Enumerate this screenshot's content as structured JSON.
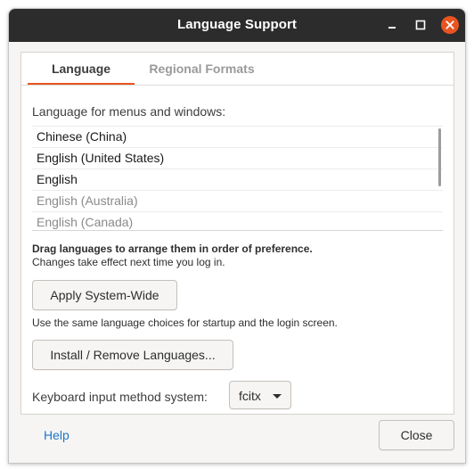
{
  "window": {
    "title": "Language Support"
  },
  "tabs": [
    {
      "label": "Language"
    },
    {
      "label": "Regional Formats"
    }
  ],
  "language": {
    "list_label": "Language for menus and windows:",
    "languages": [
      {
        "name": "Chinese (China)",
        "active": true
      },
      {
        "name": "English (United States)",
        "active": true
      },
      {
        "name": "English",
        "active": true
      },
      {
        "name": "English (Australia)",
        "active": false
      },
      {
        "name": "English (Canada)",
        "active": false
      }
    ],
    "drag_hint": "Drag languages to arrange them in order of preference.",
    "effect_hint": "Changes take effect next time you log in.",
    "apply_button": "Apply System-Wide",
    "apply_note": "Use the same language choices for startup and the login screen.",
    "install_button": "Install / Remove Languages...",
    "keyboard_label": "Keyboard input method system:",
    "keyboard_value": "fcitx"
  },
  "footer": {
    "help": "Help",
    "close": "Close"
  },
  "colors": {
    "accent": "#e95420",
    "titlebar": "#2c2c2c",
    "link": "#1f75c7"
  }
}
